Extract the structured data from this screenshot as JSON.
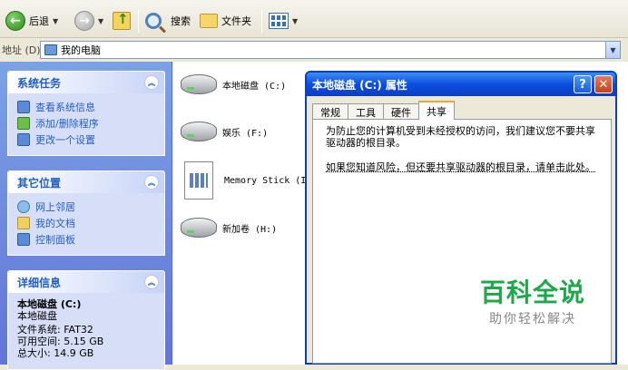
{
  "toolbar": {
    "back_label": "后退",
    "search_label": "搜索",
    "folders_label": "文件夹"
  },
  "address": {
    "label": "地址 (D)",
    "value": "我的电脑"
  },
  "sidebar": {
    "system_tasks": {
      "title": "系统任务",
      "items": [
        "查看系统信息",
        "添加/删除程序",
        "更改一个设置"
      ]
    },
    "other_places": {
      "title": "其它位置",
      "items": [
        "网上邻居",
        "我的文档",
        "控制面板"
      ]
    },
    "details": {
      "title": "详细信息",
      "name": "本地磁盘 (C:)",
      "type": "本地磁盘",
      "filesystem": "文件系统: FAT32",
      "free": "可用空间: 5.15 GB",
      "total": "总大小: 14.9 GB"
    }
  },
  "drives": [
    {
      "label": "本地磁盘 (C:)"
    },
    {
      "label": "娱乐 (F:)"
    },
    {
      "label": "Memory Stick (I"
    },
    {
      "label": "新加卷 (H:)"
    }
  ],
  "dialog": {
    "title": "本地磁盘 (C:) 属性",
    "tabs": [
      "常规",
      "工具",
      "硬件",
      "共享"
    ],
    "active_tab": "共享",
    "warning_text": "为防止您的计算机受到未经授权的访问，我们建议您不要共享驱动器的根目录。",
    "link_text": "如果您知道风险，但还要共享驱动器的根目录，请单击此处。"
  },
  "watermark": {
    "title": "百科全说",
    "subtitle": "助你轻松解决"
  },
  "colors": {
    "title_bar": "#0a3fc2",
    "sidebar_bg": "#6f8fe0",
    "task_link": "#215dc6",
    "watermark_green": "#1ea84a"
  }
}
